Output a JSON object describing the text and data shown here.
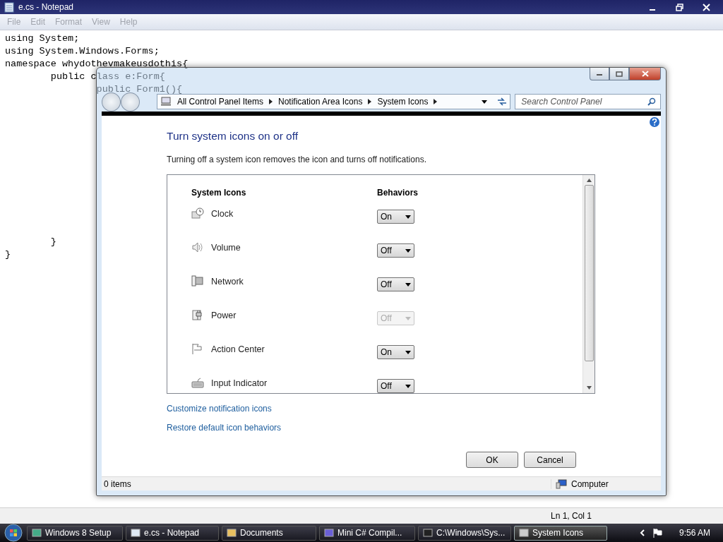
{
  "notepad": {
    "title": "e.cs - Notepad",
    "menu": [
      "File",
      "Edit",
      "Format",
      "View",
      "Help"
    ],
    "text": "using System;\nusing System.Windows.Forms;\nnamespace whydothevmakeusdothis{\n        public class e:Form{\n                public Form1(){\n\n\n\n\n\n\n\n\n\n\n\n        }\n}",
    "status": "Ln 1, Col 1"
  },
  "dialog": {
    "breadcrumb": [
      "All Control Panel Items",
      "Notification Area Icons",
      "System Icons"
    ],
    "search": {
      "placeholder": "Search Control Panel"
    },
    "heading": "Turn system icons on or off",
    "description": "Turning off a system icon removes the icon and turns off notifications.",
    "columns": [
      "System Icons",
      "Behaviors"
    ],
    "rows": [
      {
        "name": "Clock",
        "value": "On",
        "disabled": false
      },
      {
        "name": "Volume",
        "value": "Off",
        "disabled": false
      },
      {
        "name": "Network",
        "value": "Off",
        "disabled": false
      },
      {
        "name": "Power",
        "value": "Off",
        "disabled": true
      },
      {
        "name": "Action Center",
        "value": "On",
        "disabled": false
      },
      {
        "name": "Input Indicator",
        "value": "Off",
        "disabled": false
      }
    ],
    "links": [
      "Customize notification icons",
      "Restore default icon behaviors"
    ],
    "buttons": [
      "OK",
      "Cancel"
    ],
    "status_left": "0 items",
    "status_right": "Computer"
  },
  "taskbar": {
    "items": [
      {
        "label": "Windows 8 Setup",
        "selected": false
      },
      {
        "label": "e.cs - Notepad",
        "selected": false
      },
      {
        "label": "Documents",
        "selected": false
      },
      {
        "label": "Mini C# Compil...",
        "selected": false
      },
      {
        "label": "C:\\Windows\\Sys...",
        "selected": false
      },
      {
        "label": "System Icons",
        "selected": true
      }
    ],
    "clock": "9:56 AM"
  }
}
